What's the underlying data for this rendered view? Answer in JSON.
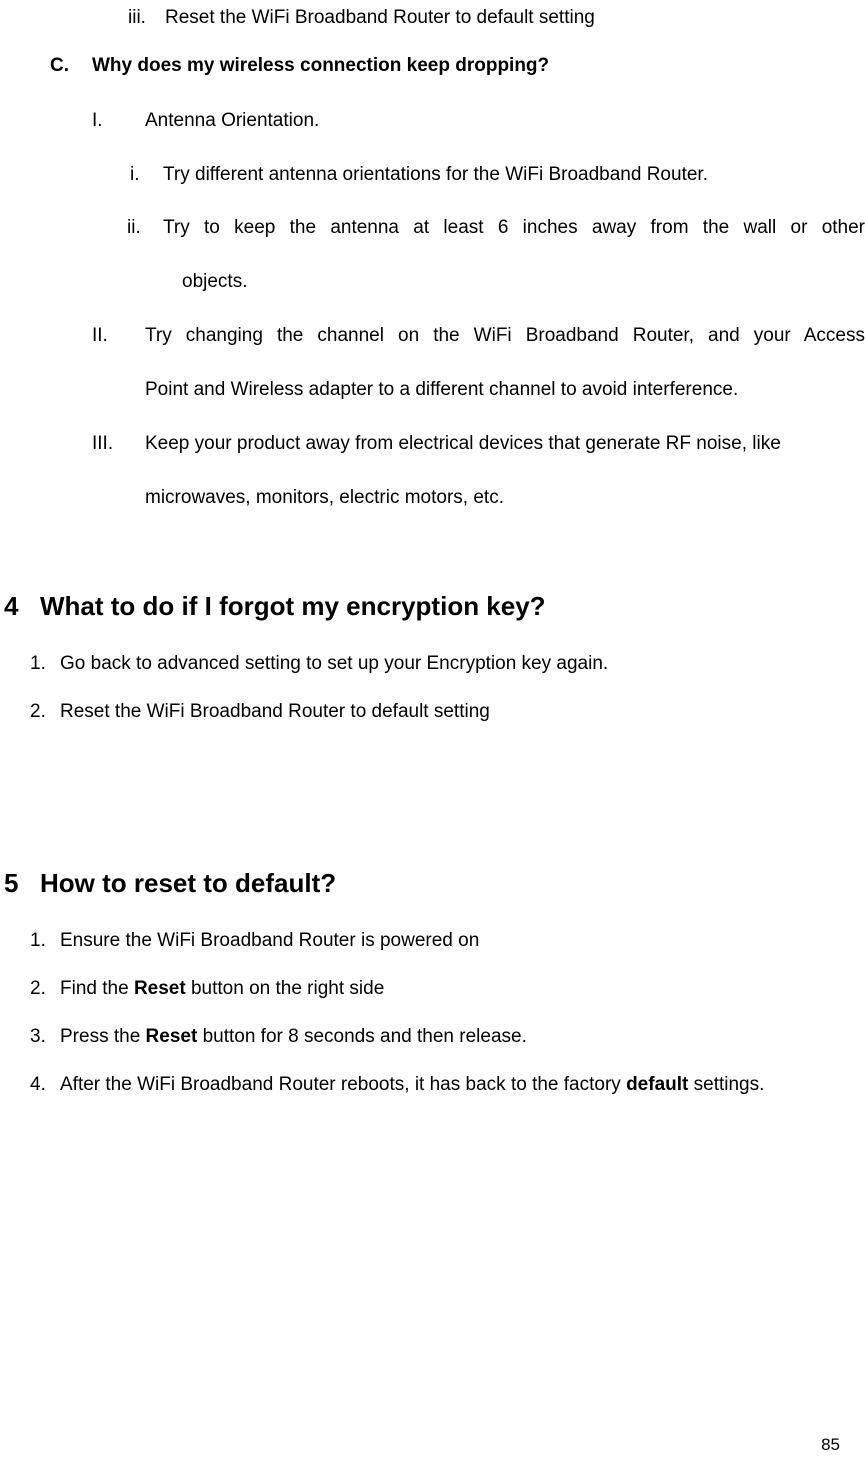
{
  "top_iii_marker": "iii.",
  "top_iii_text": "Reset the WiFi Broadband Router to default setting",
  "c_marker": "C.",
  "c_text": "Why does my wireless connection keep dropping?",
  "I_marker": "I.",
  "I_text": "Antenna Orientation.",
  "i_marker": "i.",
  "i_text": "Try different antenna orientations for the WiFi Broadband Router.",
  "ii_marker": "ii.",
  "ii_line1": "Try to keep the antenna at least 6 inches away from the wall or other",
  "ii_line2": "objects.",
  "II_marker": "II.",
  "II_line1": "Try changing the channel on the WiFi Broadband Router, and your Access",
  "II_line2": "Point and Wireless adapter to a different channel to avoid interference.",
  "III_marker": "III.",
  "III_line1": "Keep your product away from electrical devices that generate RF noise, like",
  "III_line2": "microwaves, monitors, electric motors, etc.",
  "h4_num": "4",
  "h4_text": "What to do if I forgot my encryption key?",
  "s4_1_marker": "1.",
  "s4_1_text": "Go back to advanced setting to set up your Encryption key again.",
  "s4_2_marker": "2.",
  "s4_2_text": "Reset the WiFi Broadband Router to default setting",
  "h5_num": "5",
  "h5_text": "How to reset to default?",
  "s5_1_marker": "1.",
  "s5_1_text": "Ensure the WiFi Broadband Router is powered on",
  "s5_2_marker": "2.",
  "s5_2_pre": "Find the ",
  "s5_2_bold": "Reset",
  "s5_2_post": " button on the right side",
  "s5_3_marker": "3.",
  "s5_3_pre": "Press the ",
  "s5_3_bold": "Reset",
  "s5_3_post": " button for 8 seconds and then release.",
  "s5_4_marker": "4.",
  "s5_4_pre": "After the WiFi Broadband Router reboots, it has back to the factory ",
  "s5_4_bold": "default",
  "s5_4_post": " settings.",
  "page_number": "85"
}
